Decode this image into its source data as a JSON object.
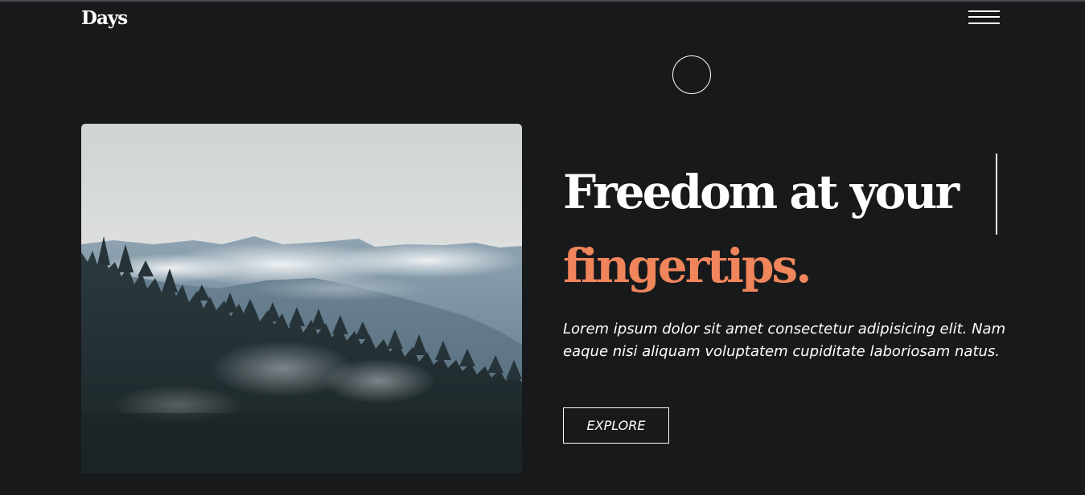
{
  "header": {
    "brand": "Days",
    "menu_icon": "hamburger-menu-icon"
  },
  "cursor": {
    "icon": "circle-cursor-icon"
  },
  "hero": {
    "image_description_icon": "forest-mountains-photo",
    "headline_line1": "Freedom at your",
    "headline_line2": "fingertips.",
    "body": "Lorem ipsum dolor sit amet consectetur adipisicing elit. Nam eaque nisi aliquam voluptatem cupiditate laboriosam natus.",
    "cta_label": "EXPLORE"
  },
  "colors": {
    "background": "#18191b",
    "accent": "#f0855b",
    "text": "#ffffff"
  }
}
